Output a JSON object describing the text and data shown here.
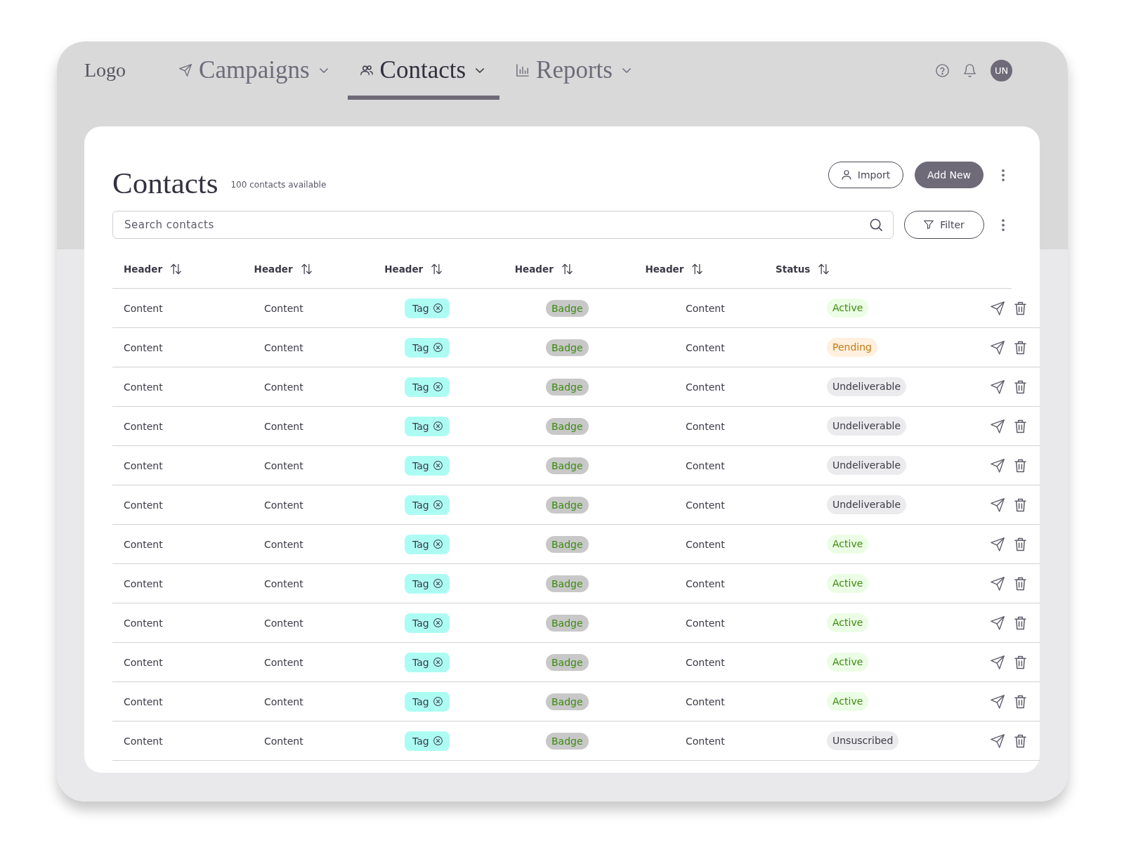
{
  "nav": {
    "logo": "Logo",
    "tabs": [
      {
        "label": "Campaigns",
        "selected": false
      },
      {
        "label": "Contacts",
        "selected": true
      },
      {
        "label": "Reports",
        "selected": false
      }
    ],
    "avatar": "UN"
  },
  "page": {
    "title": "Contacts",
    "subtitle": "100 contacts available",
    "buttons": [
      {
        "label": "Import",
        "kind": "outline"
      },
      {
        "label": "Add New",
        "kind": "primary"
      }
    ]
  },
  "search": {
    "placeholder": "Search contacts"
  },
  "filter": {
    "label": "Filter"
  },
  "table": {
    "columns": [
      "Header",
      "Header",
      "Header",
      "Header",
      "Header",
      "Status"
    ],
    "rows": [
      {
        "column_1": "Content",
        "column_2": "Content",
        "tag": "Tag",
        "badge": "Badge",
        "column_5": "Content",
        "status": {
          "label": "Active",
          "kind": "active"
        }
      },
      {
        "column_1": "Content",
        "column_2": "Content",
        "tag": "Tag",
        "badge": "Badge",
        "column_5": "Content",
        "status": {
          "label": "Pending",
          "kind": "pending"
        }
      },
      {
        "column_1": "Content",
        "column_2": "Content",
        "tag": "Tag",
        "badge": "Badge",
        "column_5": "Content",
        "status": {
          "label": "Undeliverable",
          "kind": "undeliverable"
        }
      },
      {
        "column_1": "Content",
        "column_2": "Content",
        "tag": "Tag",
        "badge": "Badge",
        "column_5": "Content",
        "status": {
          "label": "Undeliverable",
          "kind": "undeliverable"
        }
      },
      {
        "column_1": "Content",
        "column_2": "Content",
        "tag": "Tag",
        "badge": "Badge",
        "column_5": "Content",
        "status": {
          "label": "Undeliverable",
          "kind": "undeliverable"
        }
      },
      {
        "column_1": "Content",
        "column_2": "Content",
        "tag": "Tag",
        "badge": "Badge",
        "column_5": "Content",
        "status": {
          "label": "Undeliverable",
          "kind": "undeliverable"
        }
      },
      {
        "column_1": "Content",
        "column_2": "Content",
        "tag": "Tag",
        "badge": "Badge",
        "column_5": "Content",
        "status": {
          "label": "Active",
          "kind": "active"
        }
      },
      {
        "column_1": "Content",
        "column_2": "Content",
        "tag": "Tag",
        "badge": "Badge",
        "column_5": "Content",
        "status": {
          "label": "Active",
          "kind": "active"
        }
      },
      {
        "column_1": "Content",
        "column_2": "Content",
        "tag": "Tag",
        "badge": "Badge",
        "column_5": "Content",
        "status": {
          "label": "Active",
          "kind": "active"
        }
      },
      {
        "column_1": "Content",
        "column_2": "Content",
        "tag": "Tag",
        "badge": "Badge",
        "column_5": "Content",
        "status": {
          "label": "Active",
          "kind": "active"
        }
      },
      {
        "column_1": "Content",
        "column_2": "Content",
        "tag": "Tag",
        "badge": "Badge",
        "column_5": "Content",
        "status": {
          "label": "Active",
          "kind": "active"
        }
      },
      {
        "column_1": "Content",
        "column_2": "Content",
        "tag": "Tag",
        "badge": "Badge",
        "column_5": "Content",
        "status": {
          "label": "Unsuscribed",
          "kind": "unsubscribed"
        }
      }
    ]
  }
}
